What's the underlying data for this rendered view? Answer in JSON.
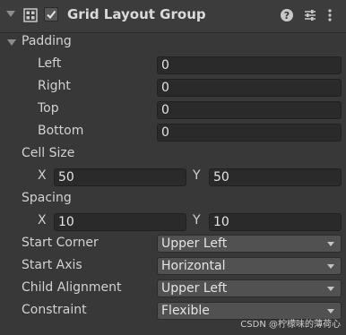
{
  "header": {
    "title": "Grid Layout Group",
    "enabled": true,
    "icons": [
      "grid-layout-icon",
      "help-icon",
      "preset-icon",
      "more-icon"
    ]
  },
  "padding": {
    "label": "Padding",
    "left": {
      "label": "Left",
      "value": "0"
    },
    "right": {
      "label": "Right",
      "value": "0"
    },
    "top": {
      "label": "Top",
      "value": "0"
    },
    "bottom": {
      "label": "Bottom",
      "value": "0"
    }
  },
  "cell_size": {
    "label": "Cell Size",
    "x_label": "X",
    "x": "50",
    "y_label": "Y",
    "y": "50"
  },
  "spacing": {
    "label": "Spacing",
    "x_label": "X",
    "x": "10",
    "y_label": "Y",
    "y": "10"
  },
  "start_corner": {
    "label": "Start Corner",
    "value": "Upper Left"
  },
  "start_axis": {
    "label": "Start Axis",
    "value": "Horizontal"
  },
  "child_alignment": {
    "label": "Child Alignment",
    "value": "Upper Left"
  },
  "constraint": {
    "label": "Constraint",
    "value": "Flexible"
  },
  "watermark": "CSDN @柠檬味的薄荷心",
  "colors": {
    "background": "#383838",
    "field": "#2a2a2a",
    "dropdown": "#515151",
    "text": "#d2d2d2"
  }
}
